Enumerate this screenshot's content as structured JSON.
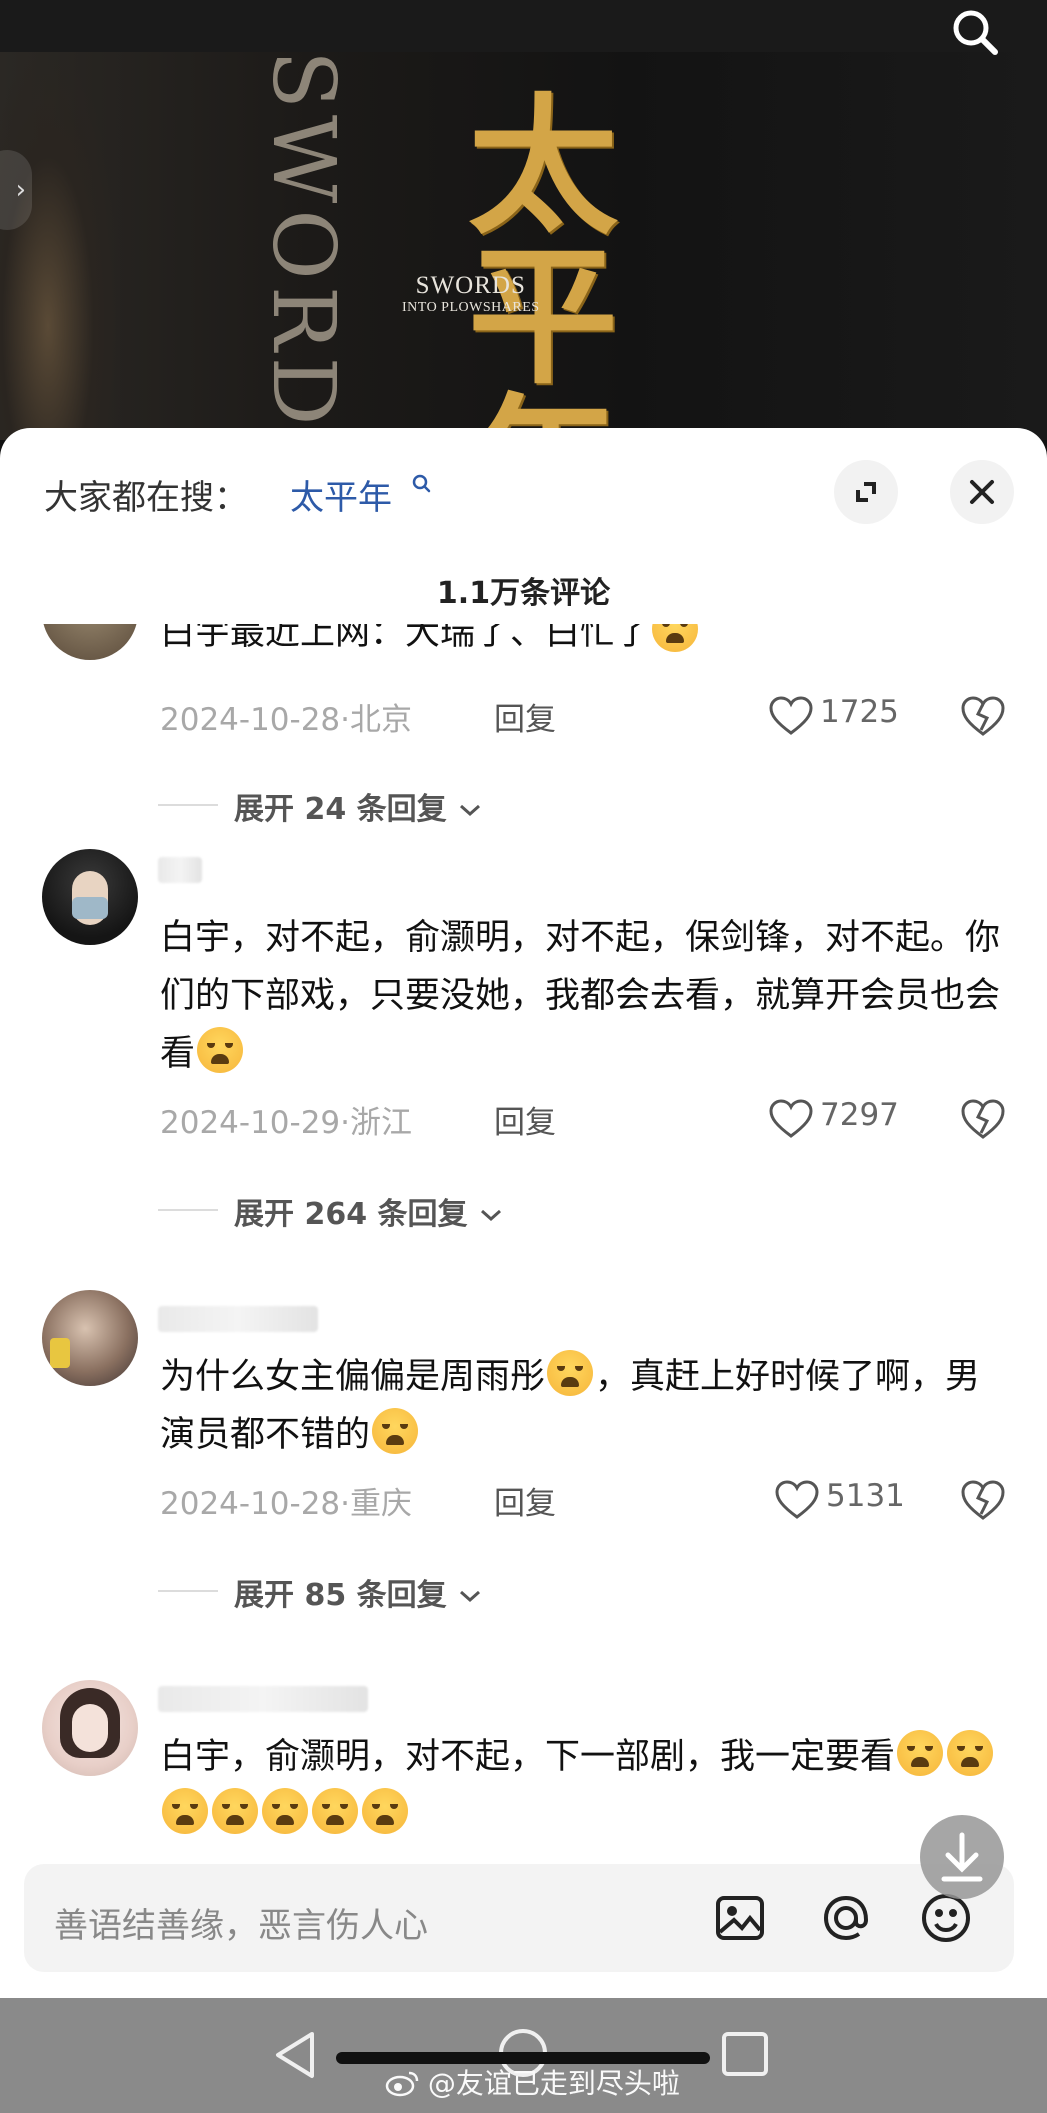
{
  "video": {
    "vertical_title": "SWORD",
    "title_en_line1": "SWORDS",
    "title_en_line2": "INTO PLOWSHARES",
    "title_cn": "太平年"
  },
  "sheet": {
    "hot_label": "大家都在搜：",
    "hot_term": "太平年",
    "count_title": "1.1万条评论"
  },
  "comments": [
    {
      "text": "白宇最近上网：大瑞了、白忙了",
      "date_loc": "2024-10-28·北京",
      "reply_label": "回复",
      "likes": "1725",
      "expand_label": "展开 24 条回复"
    },
    {
      "text": "白宇，对不起，俞灏明，对不起，保剑锋，对不起。你们的下部戏，只要没她，我都会去看，就算开会员也会看",
      "date_loc": "2024-10-29·浙江",
      "reply_label": "回复",
      "likes": "7297",
      "expand_label": "展开 264 条回复"
    },
    {
      "text_part1": "为什么女主偏偏是周雨彤",
      "text_part2": "，真赶上好时候了啊，男演员都不错的",
      "date_loc": "2024-10-28·重庆",
      "reply_label": "回复",
      "likes": "5131",
      "expand_label": "展开 85 条回复"
    },
    {
      "text": "白宇，俞灏明，对不起，下一部剧，我一定要看"
    }
  ],
  "input": {
    "placeholder": "善语结善缘，恶言伤人心"
  },
  "watermark": "@友谊已走到尽头啦",
  "icons": [
    "search-icon",
    "chevron-left-icon",
    "expand-icon",
    "close-icon",
    "heart-icon",
    "dislike-icon",
    "chevron-down-icon",
    "download-icon",
    "image-icon",
    "at-icon",
    "emoji-icon",
    "nav-back-icon",
    "nav-home-icon",
    "nav-recent-icon",
    "weibo-icon"
  ],
  "colors": {
    "accent_link": "#2d5aa8",
    "title_gold": "#d3a547",
    "sheet_bg": "#ffffff"
  }
}
